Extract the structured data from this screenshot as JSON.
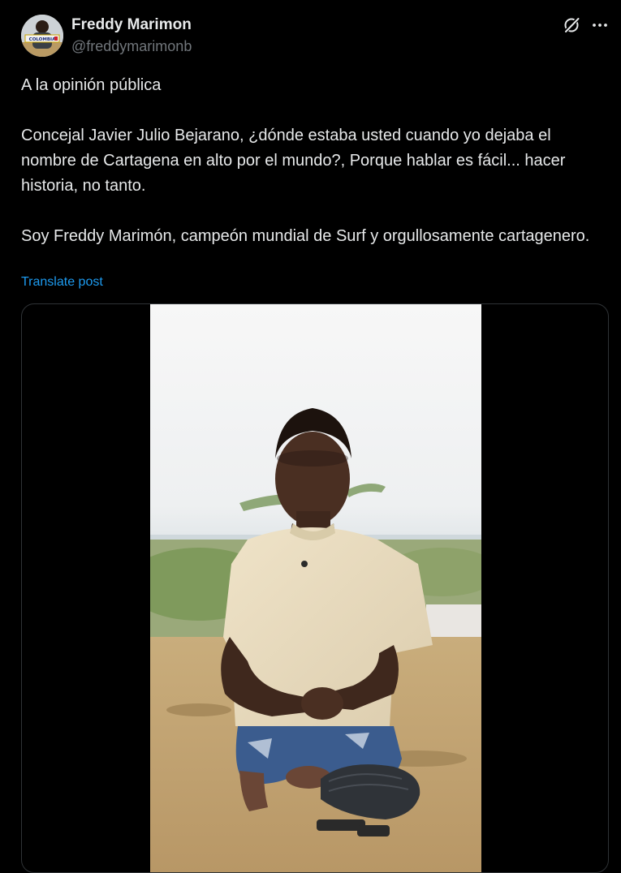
{
  "author": {
    "display_name": "Freddy Marimon",
    "handle": "@freddymarimonb",
    "avatar_sign_text": "COLOMBIA"
  },
  "header_icons": [
    "grok-icon",
    "more-options-icon"
  ],
  "tweet": {
    "paragraphs": [
      "A la opinión pública",
      "Concejal Javier Julio Bejarano, ¿dónde estaba usted cuando yo dejaba el nombre de Cartagena en alto por el mundo?, Porque hablar es fácil... hacer historia, no tanto.",
      "Soy Freddy Marimón, campeón mundial de Surf y orgullosamente cartagenero."
    ],
    "translate_label": "Translate post"
  },
  "media": {
    "type": "video"
  },
  "colors": {
    "background": "#000000",
    "text_primary": "#e7e9ea",
    "text_secondary": "#71767b",
    "link": "#1d9bf0",
    "border": "#2f3336"
  }
}
